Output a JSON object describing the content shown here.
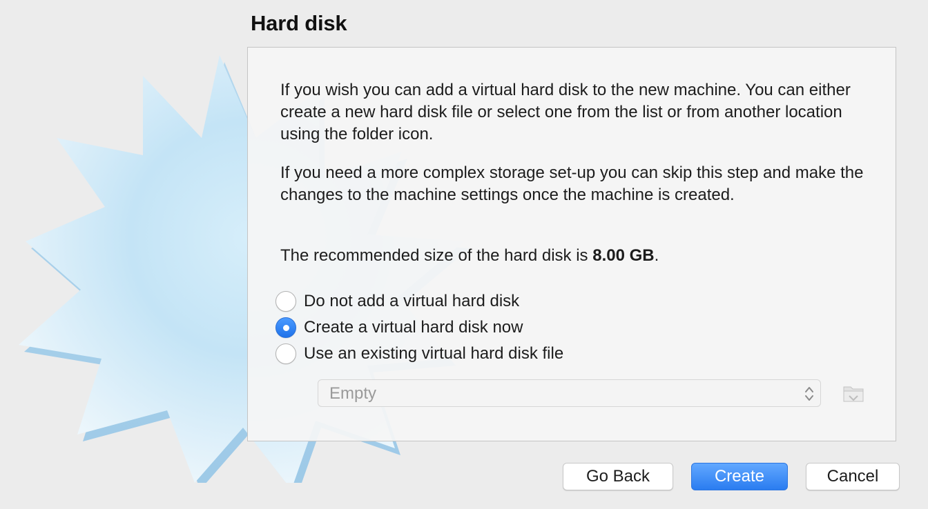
{
  "header": {
    "title": "Hard disk"
  },
  "description": {
    "paragraph1": "If you wish you can add a virtual hard disk to the new machine. You can either create a new hard disk file or select one from the list or from another location using the folder icon.",
    "paragraph2": "If you need a more complex storage set-up you can skip this step and make the changes to the machine settings once the machine is created.",
    "recommended_prefix": "The recommended size of the hard disk is ",
    "recommended_size": "8.00 GB",
    "recommended_suffix": "."
  },
  "options": [
    {
      "label": "Do not add a virtual hard disk",
      "checked": false
    },
    {
      "label": "Create a virtual hard disk now",
      "checked": true
    },
    {
      "label": "Use an existing virtual hard disk file",
      "checked": false
    }
  ],
  "disk_selector": {
    "value": "Empty",
    "disabled": true
  },
  "icons": {
    "arrows": "chevron-updown-icon",
    "folder": "folder-icon",
    "background": "starburst-graphic"
  },
  "buttons": {
    "back": "Go Back",
    "create": "Create",
    "cancel": "Cancel"
  },
  "colors": {
    "accent": "#2a7cf0",
    "window_bg": "#ececec",
    "starburst": "#bfe1f5"
  }
}
